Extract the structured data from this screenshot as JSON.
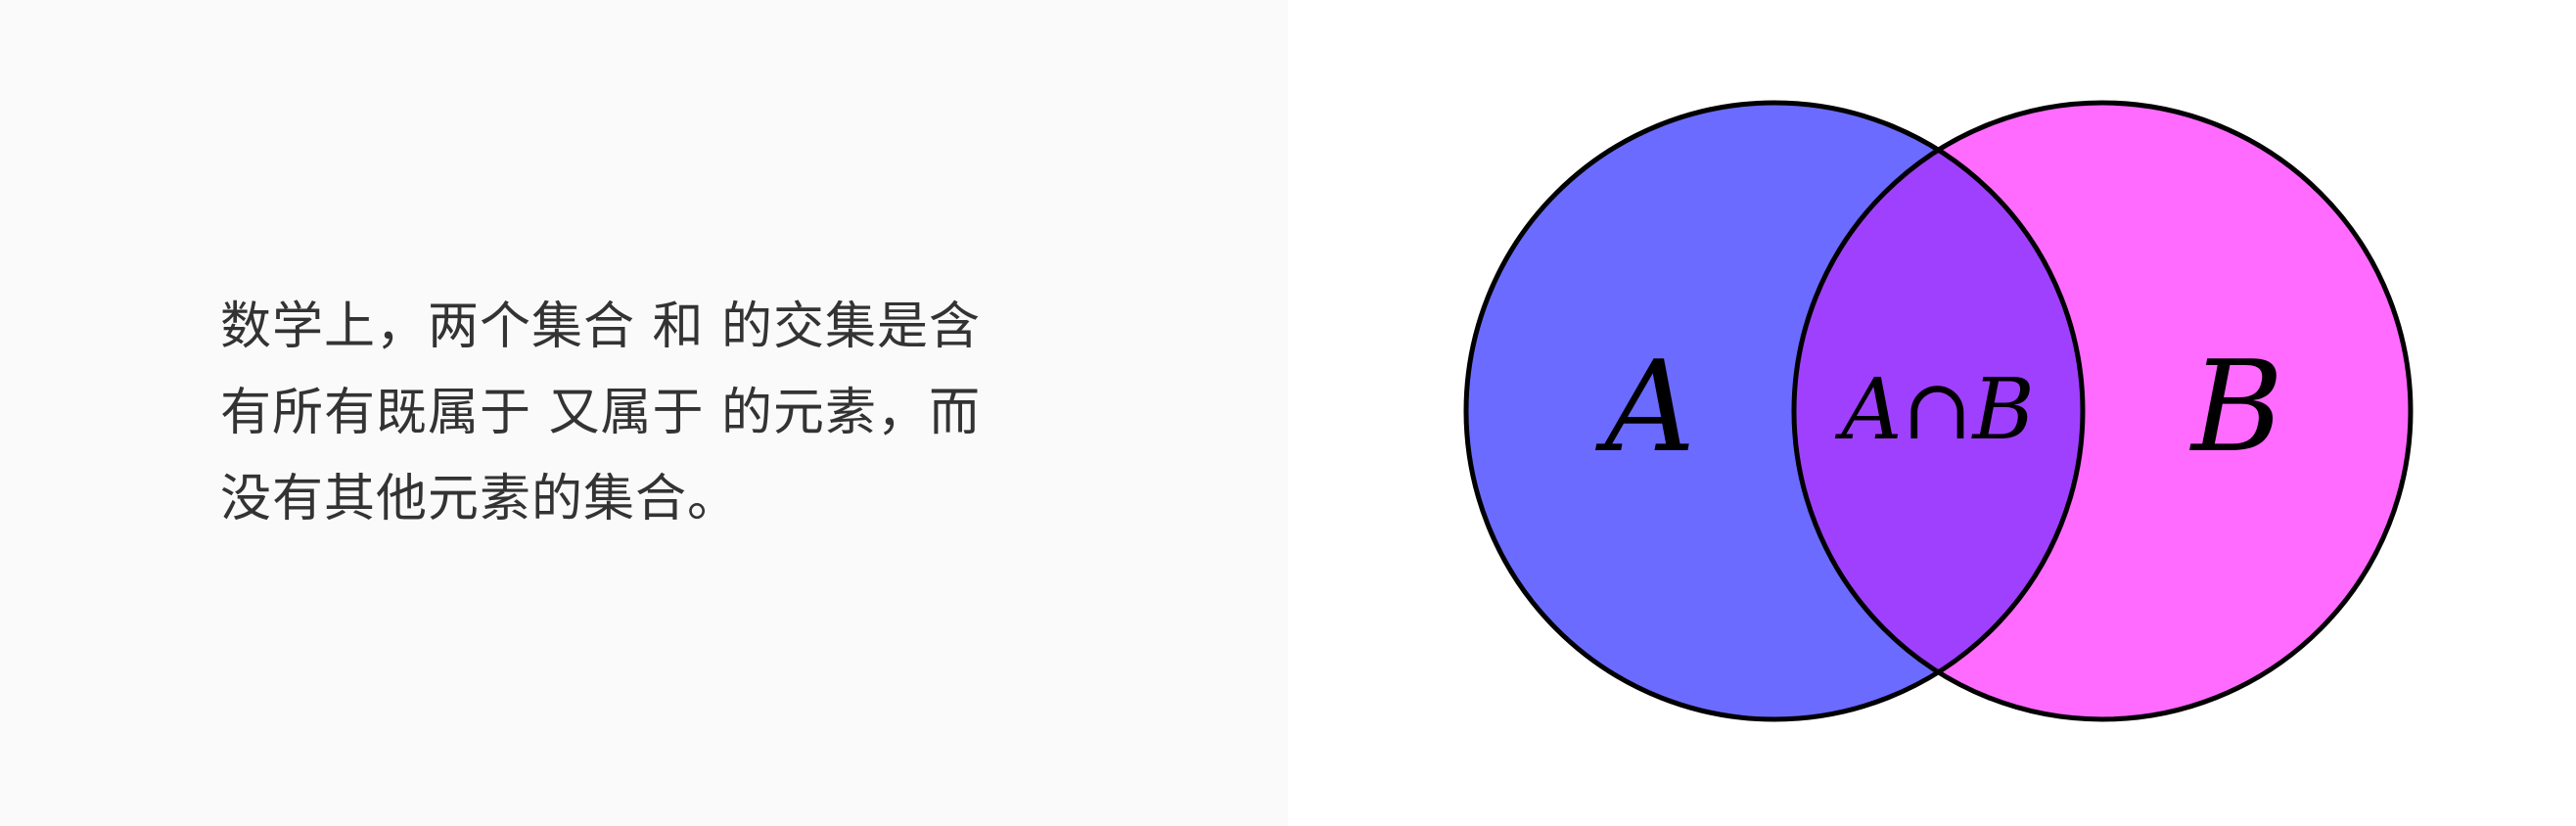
{
  "description": {
    "line1": "数学上，两个集合 和 的交集是含",
    "line2": "有所有既属于 又属于 的元素，而",
    "line3": "没有其他元素的集合。"
  },
  "diagram": {
    "set_a_label": "A",
    "set_b_label": "B",
    "intersection_label": "A∩B",
    "colors": {
      "set_a_fill": "#6b6bff",
      "set_b_fill": "#ff6bff",
      "intersection_fill": "#a040ff",
      "stroke": "#000000",
      "left_panel_bg": "#fafafa"
    }
  }
}
